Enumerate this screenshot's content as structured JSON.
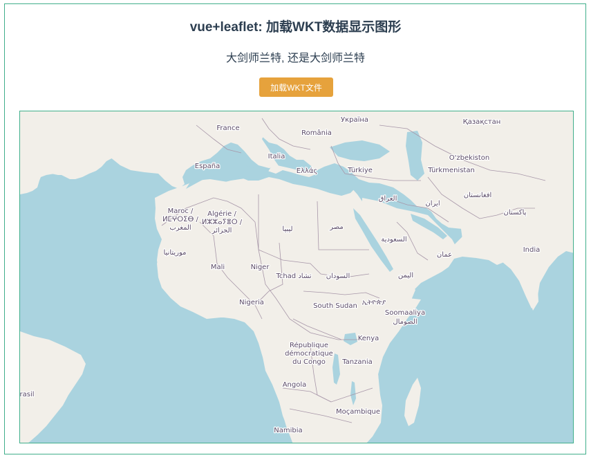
{
  "header": {
    "title": "vue+leaflet: 加载WKT数据显示图形",
    "subtitle": "大剑师兰特, 还是大剑师兰特",
    "load_button": "加载WKT文件"
  },
  "map": {
    "colors": {
      "water": "#aad3df",
      "land": "#f2efe9",
      "border": "#a796a8",
      "label": "#5a4a66"
    },
    "labels": [
      {
        "id": "ukraine",
        "text": "Україна"
      },
      {
        "id": "kazakhstan",
        "text": "Қазақстан"
      },
      {
        "id": "france",
        "text": "France"
      },
      {
        "id": "romania",
        "text": "România"
      },
      {
        "id": "uzbekistan",
        "text": "O'zbekiston"
      },
      {
        "id": "italia",
        "text": "Italia"
      },
      {
        "id": "espana",
        "text": "España"
      },
      {
        "id": "ellas",
        "text": "Ελλάς"
      },
      {
        "id": "turkiye",
        "text": "Türkiye"
      },
      {
        "id": "turkmenistan",
        "text": "Türkmenistan"
      },
      {
        "id": "iraq",
        "text": "العراق"
      },
      {
        "id": "afghanistan",
        "text": "افغانستان"
      },
      {
        "id": "maroc1",
        "text": "Maroc /"
      },
      {
        "id": "maroc2",
        "text": "ⵍⵎⵖⵔⵉⴱ /"
      },
      {
        "id": "maroc3",
        "text": "المغرب"
      },
      {
        "id": "algerie1",
        "text": "Algérie /"
      },
      {
        "id": "algerie2",
        "text": "ⵍⵣⵣⴰⵢⴻⵔ /"
      },
      {
        "id": "algerie3",
        "text": "الجزائر"
      },
      {
        "id": "iran",
        "text": "ایران"
      },
      {
        "id": "pakistan",
        "text": "پاکستان"
      },
      {
        "id": "libya",
        "text": "ليبيا"
      },
      {
        "id": "egypt",
        "text": "مصر"
      },
      {
        "id": "saudi",
        "text": "السعودية"
      },
      {
        "id": "mauritania",
        "text": "موريتانيا"
      },
      {
        "id": "oman",
        "text": "عمان"
      },
      {
        "id": "india",
        "text": "India"
      },
      {
        "id": "mali",
        "text": "Mali"
      },
      {
        "id": "niger",
        "text": "Niger"
      },
      {
        "id": "chad",
        "text": "Tchad تشاد"
      },
      {
        "id": "sudan",
        "text": "السودان"
      },
      {
        "id": "yemen",
        "text": "اليمن"
      },
      {
        "id": "ethiopia",
        "text": "ኢትዮጵያ"
      },
      {
        "id": "nigeria",
        "text": "Nigeria"
      },
      {
        "id": "southsudan",
        "text": "South Sudan"
      },
      {
        "id": "somalia1",
        "text": "Soomaaliya"
      },
      {
        "id": "somalia2",
        "text": "الصومال"
      },
      {
        "id": "kenya",
        "text": "Kenya"
      },
      {
        "id": "drc1",
        "text": "République"
      },
      {
        "id": "drc2",
        "text": "démocratique"
      },
      {
        "id": "drc3",
        "text": "du Congo"
      },
      {
        "id": "tanzania",
        "text": "Tanzania"
      },
      {
        "id": "brasil",
        "text": "rasil"
      },
      {
        "id": "angola",
        "text": "Angola"
      },
      {
        "id": "mocambique",
        "text": "Moçambique"
      },
      {
        "id": "namibia",
        "text": "Namibia"
      }
    ]
  }
}
